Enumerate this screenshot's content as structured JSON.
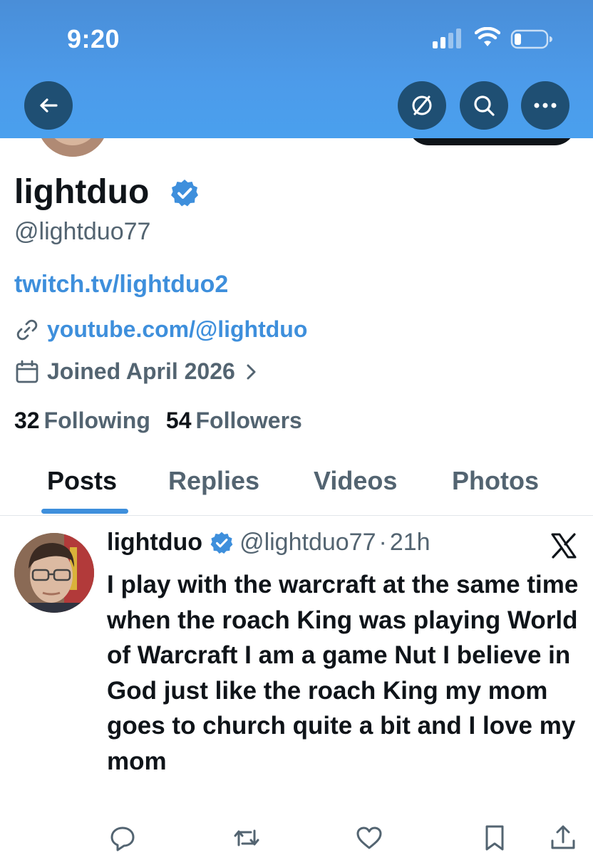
{
  "status_bar": {
    "time": "9:20"
  },
  "colors": {
    "header_blue": "#4c9bea",
    "header_button": "#1f4f73",
    "link_blue": "#3e8fdc",
    "verified_blue": "#3e8fdc",
    "muted_text": "#536471",
    "text": "#0f1419"
  },
  "header": {
    "icons": [
      "back-arrow-icon",
      "translate-icon",
      "search-icon",
      "more-icon"
    ]
  },
  "profile": {
    "display_name": "lightduo",
    "handle": "@lightduo77",
    "bio_link": "twitch.tv/lightduo2",
    "website": "youtube.com/@lightduo",
    "joined": "Joined April 2026",
    "following_count": "32",
    "following_label": "Following",
    "followers_count": "54",
    "followers_label": "Followers"
  },
  "tabs": [
    {
      "label": "Posts",
      "active": true
    },
    {
      "label": "Replies",
      "active": false
    },
    {
      "label": "Videos",
      "active": false
    },
    {
      "label": "Photos",
      "active": false
    }
  ],
  "post": {
    "name": "lightduo",
    "handle": "@lightduo77",
    "separator": "·",
    "time": "21h",
    "text": "I play with the warcraft at the same time when the roach King was playing World of Warcraft I am a game Nut I believe in God just like the roach King my mom goes to church quite a bit and I love my mom",
    "action_icons": [
      "reply-icon",
      "repost-icon",
      "like-icon",
      "bookmark-icon",
      "share-icon"
    ]
  }
}
